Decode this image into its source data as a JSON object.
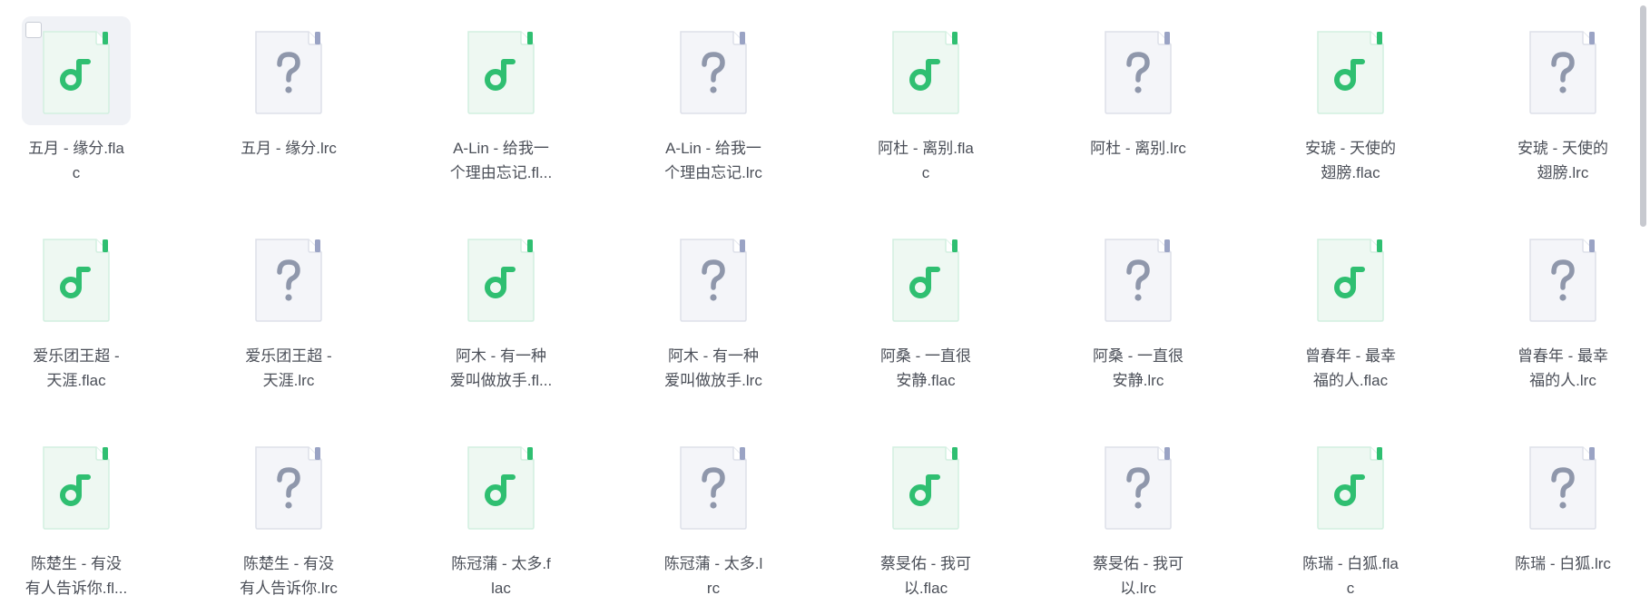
{
  "colors": {
    "music_green": "#2fbf71",
    "unknown_gray": "#8f97ab",
    "label_text": "#4b4f58"
  },
  "files": [
    {
      "name": "五月 - 缘分.flac",
      "line1": "五月 - 缘分.fla",
      "line2": "c",
      "icon": "music-file-icon"
    },
    {
      "name": "五月 - 缘分.lrc",
      "line1": "五月 - 缘分.lrc",
      "line2": "",
      "icon": "unknown-file-icon"
    },
    {
      "name": "A-Lin - 给我一个理由忘记.flac",
      "line1": "A-Lin - 给我一",
      "line2": "个理由忘记.fl...",
      "icon": "music-file-icon"
    },
    {
      "name": "A-Lin - 给我一个理由忘记.lrc",
      "line1": "A-Lin - 给我一",
      "line2": "个理由忘记.lrc",
      "icon": "unknown-file-icon"
    },
    {
      "name": "阿杜 - 离别.flac",
      "line1": "阿杜 - 离别.fla",
      "line2": "c",
      "icon": "music-file-icon"
    },
    {
      "name": "阿杜 - 离别.lrc",
      "line1": "阿杜 - 离别.lrc",
      "line2": "",
      "icon": "unknown-file-icon"
    },
    {
      "name": "安琥 - 天使的翅膀.flac",
      "line1": "安琥 - 天使的",
      "line2": "翅膀.flac",
      "icon": "music-file-icon"
    },
    {
      "name": "安琥 - 天使的翅膀.lrc",
      "line1": "安琥 - 天使的",
      "line2": "翅膀.lrc",
      "icon": "unknown-file-icon"
    },
    {
      "name": "爱乐团王超 - 天涯.flac",
      "line1": "爱乐团王超 -",
      "line2": "天涯.flac",
      "icon": "music-file-icon"
    },
    {
      "name": "爱乐团王超 - 天涯.lrc",
      "line1": "爱乐团王超 -",
      "line2": "天涯.lrc",
      "icon": "unknown-file-icon"
    },
    {
      "name": "阿木 - 有一种爱叫做放手.flac",
      "line1": "阿木 - 有一种",
      "line2": "爱叫做放手.fl...",
      "icon": "music-file-icon"
    },
    {
      "name": "阿木 - 有一种爱叫做放手.lrc",
      "line1": "阿木 - 有一种",
      "line2": "爱叫做放手.lrc",
      "icon": "unknown-file-icon"
    },
    {
      "name": "阿桑 - 一直很安静.flac",
      "line1": "阿桑 - 一直很",
      "line2": "安静.flac",
      "icon": "music-file-icon"
    },
    {
      "name": "阿桑 - 一直很安静.lrc",
      "line1": "阿桑 - 一直很",
      "line2": "安静.lrc",
      "icon": "unknown-file-icon"
    },
    {
      "name": "曾春年 - 最幸福的人.flac",
      "line1": "曾春年 - 最幸",
      "line2": "福的人.flac",
      "icon": "music-file-icon"
    },
    {
      "name": "曾春年 - 最幸福的人.lrc",
      "line1": "曾春年 - 最幸",
      "line2": "福的人.lrc",
      "icon": "unknown-file-icon"
    },
    {
      "name": "陈楚生 - 有没有人告诉你.flac",
      "line1": "陈楚生 - 有没",
      "line2": "有人告诉你.fl...",
      "icon": "music-file-icon"
    },
    {
      "name": "陈楚生 - 有没有人告诉你.lrc",
      "line1": "陈楚生 - 有没",
      "line2": "有人告诉你.lrc",
      "icon": "unknown-file-icon"
    },
    {
      "name": "陈冠蒲 - 太多.flac",
      "line1": "陈冠蒲 - 太多.f",
      "line2": "lac",
      "icon": "music-file-icon"
    },
    {
      "name": "陈冠蒲 - 太多.lrc",
      "line1": "陈冠蒲 - 太多.l",
      "line2": "rc",
      "icon": "unknown-file-icon"
    },
    {
      "name": "蔡旻佑 - 我可以.flac",
      "line1": "蔡旻佑 - 我可",
      "line2": "以.flac",
      "icon": "music-file-icon"
    },
    {
      "name": "蔡旻佑 - 我可以.lrc",
      "line1": "蔡旻佑 - 我可",
      "line2": "以.lrc",
      "icon": "unknown-file-icon"
    },
    {
      "name": "陈瑞 - 白狐.flac",
      "line1": "陈瑞 - 白狐.fla",
      "line2": "c",
      "icon": "music-file-icon"
    },
    {
      "name": "陈瑞 - 白狐.lrc",
      "line1": "陈瑞 - 白狐.lrc",
      "line2": "",
      "icon": "unknown-file-icon"
    }
  ]
}
